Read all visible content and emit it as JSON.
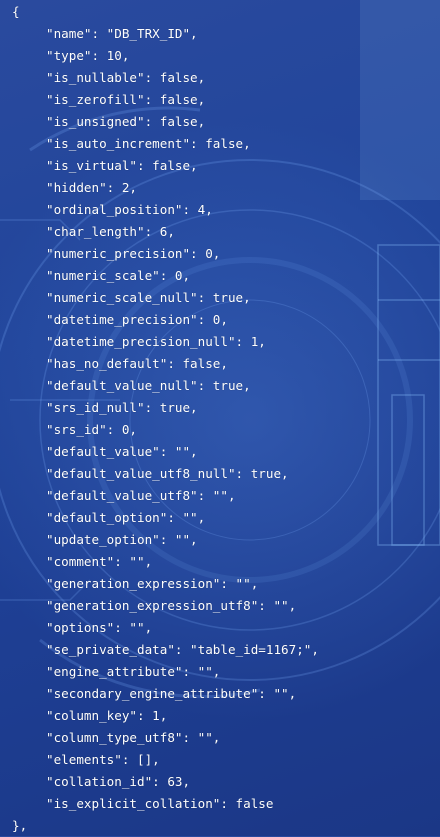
{
  "code": {
    "open_brace": "{",
    "close_brace": "},",
    "fields": [
      "\"name\": \"DB_TRX_ID\",",
      "\"type\": 10,",
      "\"is_nullable\": false,",
      "\"is_zerofill\": false,",
      "\"is_unsigned\": false,",
      "\"is_auto_increment\": false,",
      "\"is_virtual\": false,",
      "\"hidden\": 2,",
      "\"ordinal_position\": 4,",
      "\"char_length\": 6,",
      "\"numeric_precision\": 0,",
      "\"numeric_scale\": 0,",
      "\"numeric_scale_null\": true,",
      "\"datetime_precision\": 0,",
      "\"datetime_precision_null\": 1,",
      "\"has_no_default\": false,",
      "\"default_value_null\": true,",
      "\"srs_id_null\": true,",
      "\"srs_id\": 0,",
      "\"default_value\": \"\",",
      "\"default_value_utf8_null\": true,",
      "\"default_value_utf8\": \"\",",
      "\"default_option\": \"\",",
      "\"update_option\": \"\",",
      "\"comment\": \"\",",
      "\"generation_expression\": \"\",",
      "\"generation_expression_utf8\": \"\",",
      "\"options\": \"\",",
      "\"se_private_data\": \"table_id=1167;\",",
      "\"engine_attribute\": \"\",",
      "\"secondary_engine_attribute\": \"\",",
      "\"column_key\": 1,",
      "\"column_type_utf8\": \"\",",
      "\"elements\": [],",
      "\"collation_id\": 63,",
      "\"is_explicit_collation\": false"
    ]
  },
  "colors": {
    "background": "#21459b",
    "text": "#ffffff"
  }
}
